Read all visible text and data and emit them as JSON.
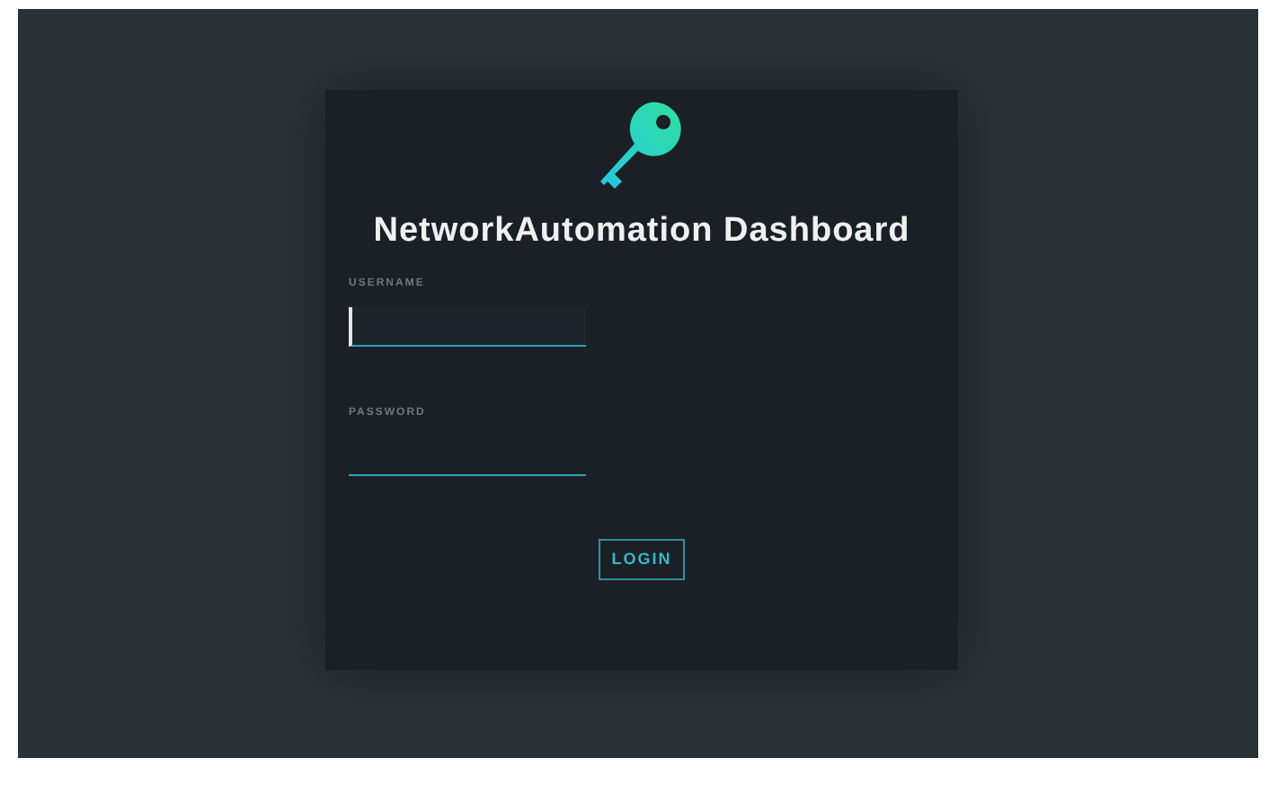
{
  "title": "NetworkAutomation Dashboard",
  "fields": [
    {
      "label": "USERNAME",
      "focused": true
    },
    {
      "label": "PASSWORD",
      "focused": false
    }
  ],
  "button": "LOGIN"
}
